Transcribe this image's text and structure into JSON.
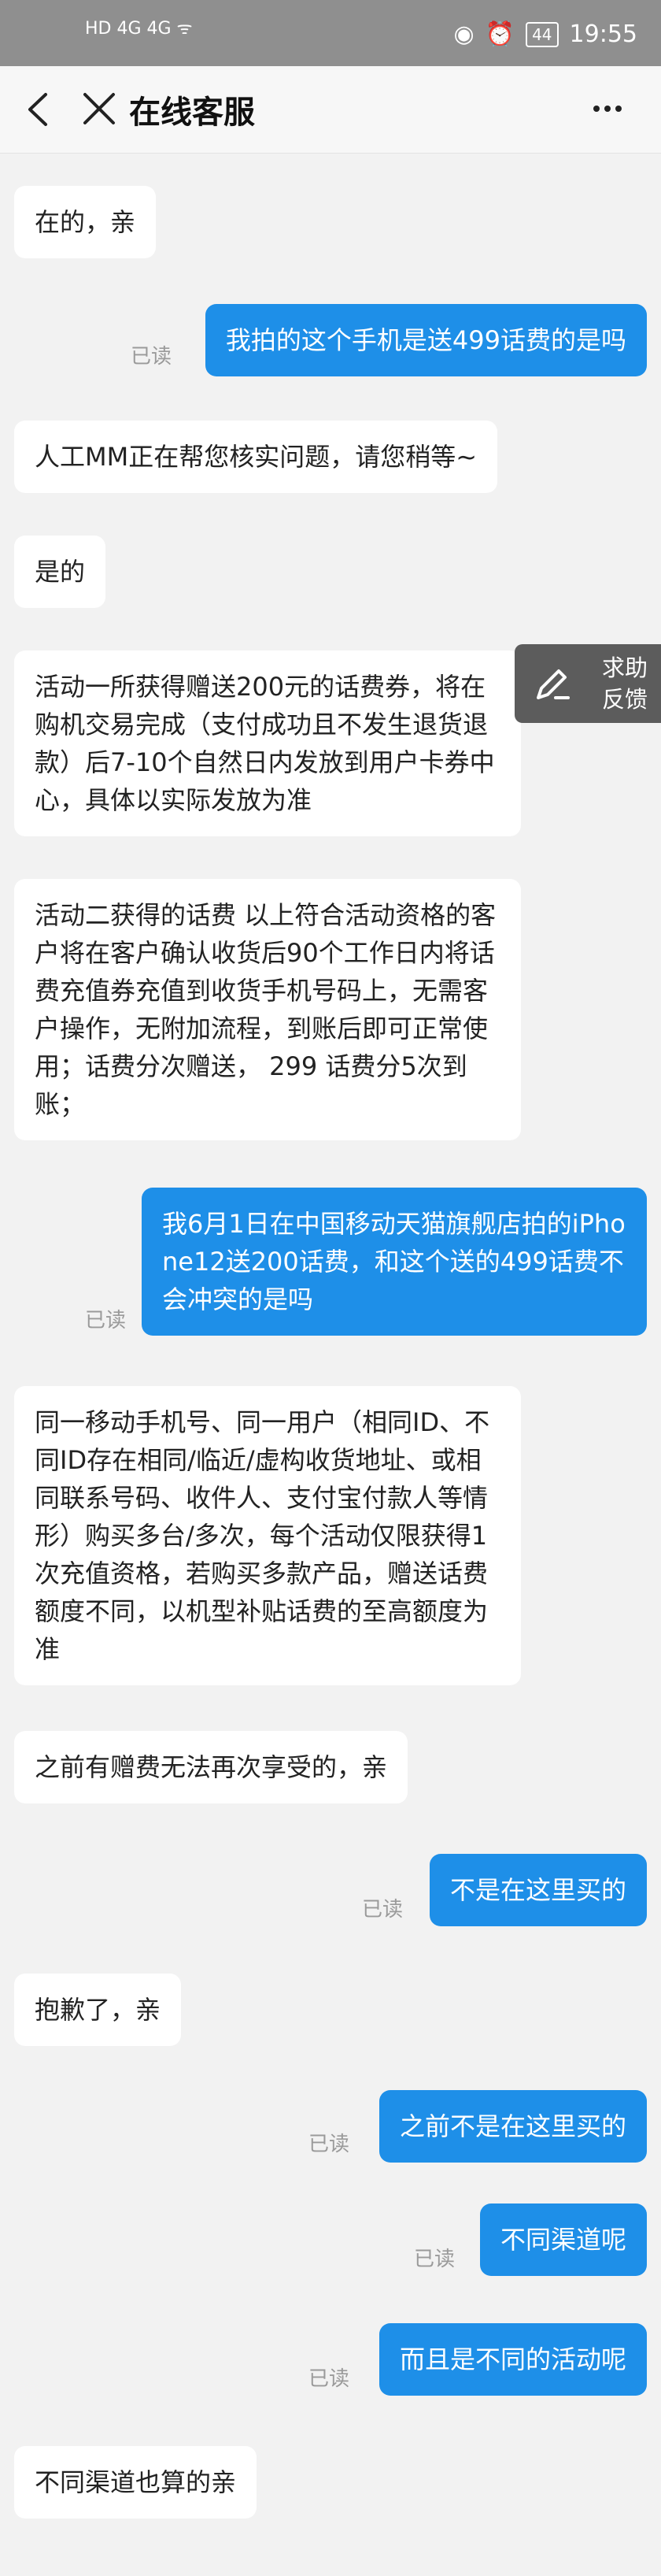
{
  "status_bar": {
    "left_indicators": "HD 4G  4G  ᯤ",
    "battery": "44",
    "time": "19:55"
  },
  "nav": {
    "title": "在线客服"
  },
  "help_button": {
    "label_line1": "求助",
    "label_line2": "反馈"
  },
  "read_label": "已读",
  "messages": [
    {
      "side": "left",
      "text": "在的，亲"
    },
    {
      "side": "right",
      "text": "我拍的这个手机是送499话费的是吗"
    },
    {
      "side": "left",
      "text": "人工MM正在帮您核实问题，请您稍等~"
    },
    {
      "side": "left",
      "text": "是的"
    },
    {
      "side": "left",
      "text": "活动一所获得赠送200元的话费券，将在购机交易完成（支付成功且不发生退货退款）后7-10个自然日内发放到用户卡券中心，具体以实际发放为准"
    },
    {
      "side": "left",
      "text": "活动二获得的话费 以上符合活动资格的客户将在客户确认收货后90个工作日内将话费充值券充值到收货手机号码上，无需客户操作，无附加流程，到账后即可正常使用；话费分次赠送， 299 话费分5次到账；"
    },
    {
      "side": "right",
      "text": "我6月1日在中国移动天猫旗舰店拍的iPhone12送200话费，和这个送的499话费不会冲突的是吗"
    },
    {
      "side": "left",
      "text": "同一移动手机号、同一用户（相同ID、不同ID存在相同/临近/虚构收货地址、或相同联系号码、收件人、支付宝付款人等情形）购买多台/多次，每个活动仅限获得1次充值资格，若购买多款产品，赠送话费额度不同，以机型补贴话费的至高额度为准"
    },
    {
      "side": "left",
      "text": "之前有赠费无法再次享受的，亲"
    },
    {
      "side": "right",
      "text": "不是在这里买的"
    },
    {
      "side": "left",
      "text": "抱歉了，亲"
    },
    {
      "side": "right",
      "text": "之前不是在这里买的"
    },
    {
      "side": "right",
      "text": "不同渠道呢"
    },
    {
      "side": "right",
      "text": "而且是不同的活动呢"
    },
    {
      "side": "left",
      "text": "不同渠道也算的亲"
    }
  ]
}
